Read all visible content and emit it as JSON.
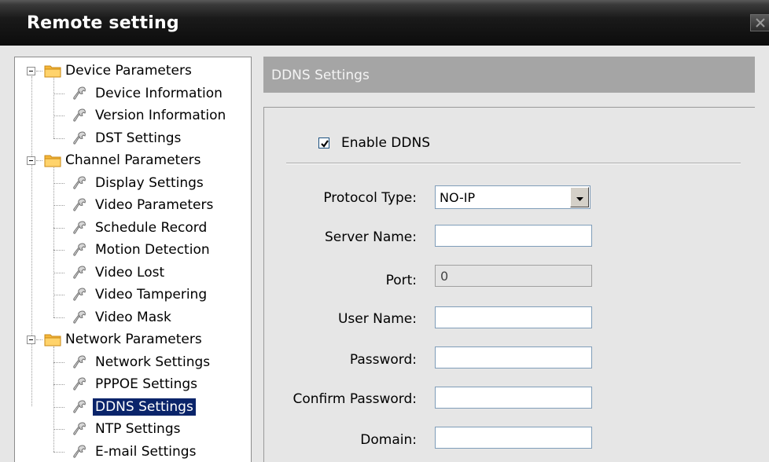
{
  "window": {
    "title": "Remote setting"
  },
  "tree": {
    "groups": [
      {
        "label": "Device Parameters",
        "items": [
          "Device Information",
          "Version Information",
          "DST Settings"
        ]
      },
      {
        "label": "Channel Parameters",
        "items": [
          "Display Settings",
          "Video Parameters",
          "Schedule Record",
          "Motion Detection",
          "Video Lost",
          "Video Tampering",
          "Video Mask"
        ]
      },
      {
        "label": "Network Parameters",
        "items": [
          "Network Settings",
          "PPPOE Settings",
          "DDNS Settings",
          "NTP Settings",
          "E-mail Settings"
        ]
      }
    ],
    "selected": "DDNS Settings"
  },
  "section": {
    "title": "DDNS Settings"
  },
  "ddns": {
    "enable_label": "Enable DDNS",
    "enabled": true,
    "protocol_label": "Protocol Type:",
    "protocol_value": "NO-IP",
    "server_label": "Server Name:",
    "server_value": "",
    "port_label": "Port:",
    "port_value": "0",
    "user_label": "User Name:",
    "user_value": "",
    "password_label": "Password:",
    "password_value": "",
    "confirm_label": "Confirm Password:",
    "confirm_value": "",
    "domain_label": "Domain:",
    "domain_value": ""
  },
  "colors": {
    "selection": "#0a246a",
    "header_bg": "#a5a5a5",
    "panel_bg": "#e6e6e6"
  },
  "icons": {
    "folder": "folder-icon",
    "leaf": "wrench-icon",
    "close": "close-icon",
    "dropdown": "chevron-down-icon"
  }
}
